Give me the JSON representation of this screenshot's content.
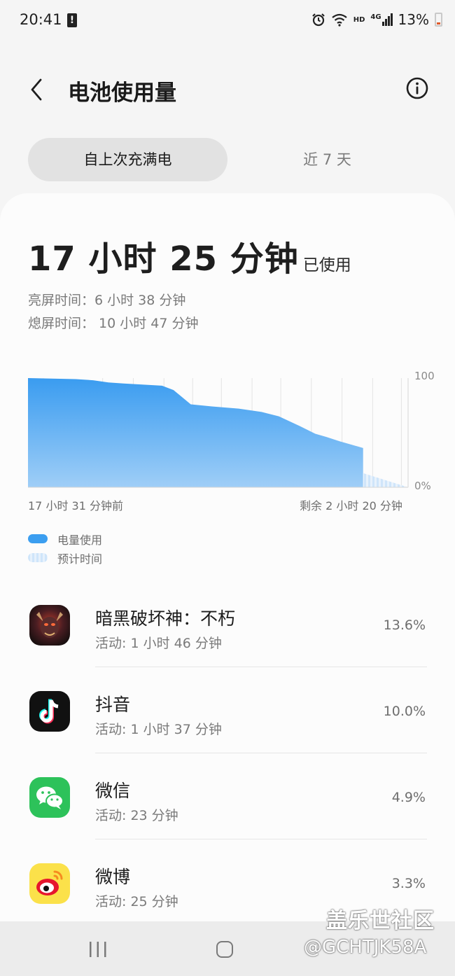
{
  "status_bar": {
    "time": "20:41",
    "battery_text": "13%",
    "hd_label": "HD",
    "network_label": "4G",
    "icons": [
      "alert-icon",
      "alarm-icon",
      "wifi-icon",
      "hd-icon",
      "signal-icon",
      "battery-icon"
    ]
  },
  "header": {
    "title": "电池使用量"
  },
  "tabs": [
    {
      "label": "自上次充满电",
      "active": true
    },
    {
      "label": "近 7 天",
      "active": false
    }
  ],
  "summary": {
    "total_time": "17 小时 25 分钟",
    "total_suffix": "已使用",
    "screen_on": "亮屏时间：6 小时 38 分钟",
    "screen_off": "熄屏时间： 10 小时 47 分钟"
  },
  "chart_data": {
    "type": "area",
    "y_top_label": "100",
    "y_bottom_label": "0%",
    "x_start_label": "17 小时 31 分钟前",
    "x_end_label": "剩余 2 小时 20 分钟",
    "ylim": [
      0,
      100
    ],
    "xlim_hours": [
      0,
      19.85
    ],
    "usage_series": {
      "x": [
        0,
        2.5,
        3.4,
        4.2,
        5.0,
        7.0,
        7.6,
        8.5,
        9.6,
        11.0,
        12.2,
        13.1,
        14.2,
        15.0,
        15.6,
        16.3,
        17.5
      ],
      "y": [
        100,
        99,
        98,
        96,
        95,
        93,
        89,
        76,
        74,
        72,
        69,
        65,
        56,
        49,
        46,
        42,
        36
      ]
    },
    "estimate_series": {
      "x": [
        17.5,
        19.85
      ],
      "y": [
        13,
        0
      ]
    },
    "gridlines_hours": [
      0.8,
      3.9,
      5.5,
      7.1,
      8.6,
      10.1,
      11.7,
      13.2,
      14.8,
      16.4,
      18.0,
      19.5
    ],
    "colors": {
      "usage_top": "#3a9cf0",
      "usage_bottom": "#9fcef7",
      "estimate": "#cfe5fa"
    }
  },
  "legend": [
    {
      "label": "电量使用",
      "kind": "usage"
    },
    {
      "label": "预计时间",
      "kind": "estimate"
    }
  ],
  "apps": [
    {
      "name": "暗黑破坏神：不朽",
      "active": "活动: 1 小时 46 分钟",
      "percent": "13.6%",
      "icon": "diablo-icon"
    },
    {
      "name": "抖音",
      "active": "活动: 1 小时 37 分钟",
      "percent": "10.0%",
      "icon": "douyin-icon"
    },
    {
      "name": "微信",
      "active": "活动: 23 分钟",
      "percent": "4.9%",
      "icon": "wechat-icon"
    },
    {
      "name": "微博",
      "active": "活动: 25 分钟",
      "percent": "3.3%",
      "icon": "weibo-icon"
    }
  ],
  "watermark": {
    "line1": "盖乐世社区",
    "line2": "@GCHTJK58A"
  }
}
